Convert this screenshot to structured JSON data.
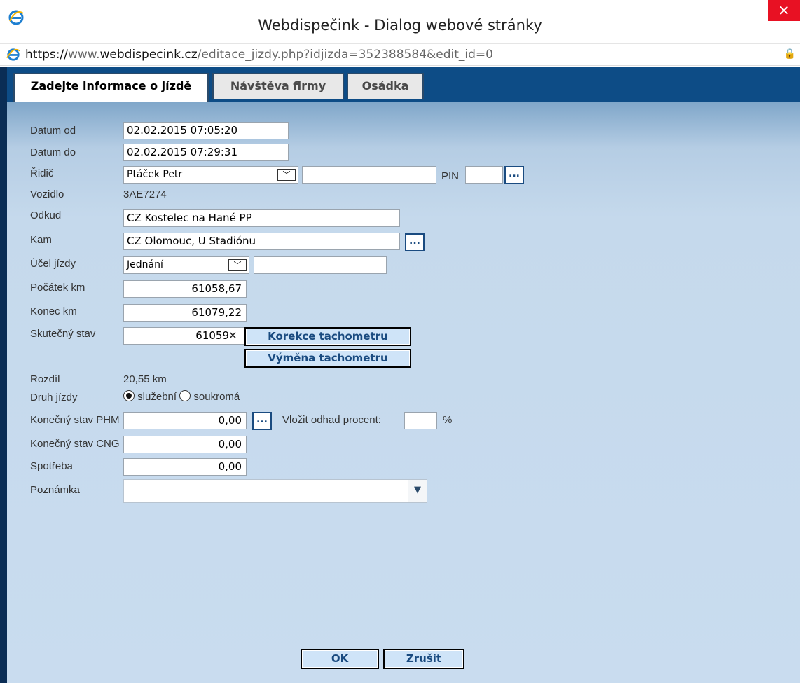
{
  "window": {
    "title": "Webdispečink - Dialog webové stránky",
    "close_symbol": "✕",
    "url_scheme": "https://",
    "url_host_pre": "www.",
    "url_host": "webdispecink.cz",
    "url_path": "/editace_jizdy.php?idjizda=352388584&edit_id=0"
  },
  "tabs": [
    {
      "label": "Zadejte informace o jízdě",
      "active": true
    },
    {
      "label": "Návštěva firmy",
      "active": false
    },
    {
      "label": "Osádka",
      "active": false
    }
  ],
  "form": {
    "datum_od": {
      "label": "Datum od",
      "value": "02.02.2015 07:05:20"
    },
    "datum_do": {
      "label": "Datum do",
      "value": "02.02.2015 07:29:31"
    },
    "ridic": {
      "label": "Řidič",
      "value": "Ptáček Petr",
      "extra_value": "",
      "pin_label": "PIN",
      "pin_value": ""
    },
    "vozidlo": {
      "label": "Vozidlo",
      "value": "3AE7274"
    },
    "odkud": {
      "label": "Odkud",
      "value": "CZ Kostelec na Hané PP"
    },
    "kam": {
      "label": "Kam",
      "value": "CZ Olomouc, U Stadiónu"
    },
    "ucel": {
      "label": "Účel jízdy",
      "value": "Jednání",
      "extra_value": ""
    },
    "pocatek_km": {
      "label": "Počátek km",
      "value": "61058,67"
    },
    "konec_km": {
      "label": "Konec km",
      "value": "61079,22"
    },
    "skutecny_stav": {
      "label": "Skutečný stav",
      "value": "61059",
      "clear_symbol": "✕"
    },
    "korekce_btn": "Korekce tachometru",
    "vymena_btn": "Výměna tachometru",
    "rozdil": {
      "label": "Rozdíl",
      "value": "20,55 km"
    },
    "druh": {
      "label": "Druh jízdy",
      "option1": "služební",
      "option2": "soukromá",
      "selected": "služební"
    },
    "phm": {
      "label": "Konečný stav PHM",
      "value": "0,00",
      "odhad_label": "Vložit odhad procent:",
      "odhad_value": "",
      "percent": "%"
    },
    "cng": {
      "label": "Konečný stav CNG",
      "value": "0,00"
    },
    "spotreba": {
      "label": "Spotřeba",
      "value": "0,00"
    },
    "poznamka": {
      "label": "Poznámka",
      "value": ""
    },
    "dots_label": "..."
  },
  "buttons": {
    "ok": "OK",
    "cancel": "Zrušit"
  },
  "colors": {
    "close": "#e81123",
    "tabstrip": "#0d4c86",
    "panel": "#c9dcef",
    "button_text": "#1a4b80"
  }
}
